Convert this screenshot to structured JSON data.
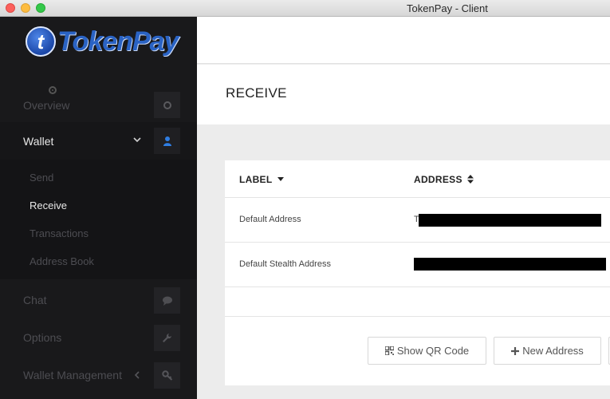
{
  "window": {
    "title": "TokenPay - Client"
  },
  "brand": {
    "logo_text": "TokenPay",
    "logo_mark": "t"
  },
  "sidebar": {
    "items": [
      {
        "label": "Overview",
        "icon": "circle-icon"
      },
      {
        "label": "Wallet",
        "icon": "user-icon"
      },
      {
        "label": "Chat",
        "icon": "chat-bubble-icon"
      },
      {
        "label": "Options",
        "icon": "wrench-icon"
      },
      {
        "label": "Wallet Management",
        "icon": "key-icon"
      }
    ],
    "wallet_submenu": [
      "Send",
      "Receive",
      "Transactions",
      "Address Book"
    ],
    "active_item": "Wallet",
    "active_subitem": "Receive"
  },
  "page": {
    "title": "RECEIVE"
  },
  "table": {
    "columns": [
      "LABEL",
      "ADDRESS"
    ],
    "rows": [
      {
        "label": "Default Address",
        "address_prefix": "T"
      },
      {
        "label": "Default Stealth Address",
        "address_prefix": ""
      }
    ]
  },
  "buttons": {
    "show_qr": "Show QR Code",
    "new_address": "New Address"
  },
  "colors": {
    "sidebar_bg": "#19191b",
    "brand_blue": "#2a63c4",
    "accent_icon": "#2f7de1"
  }
}
